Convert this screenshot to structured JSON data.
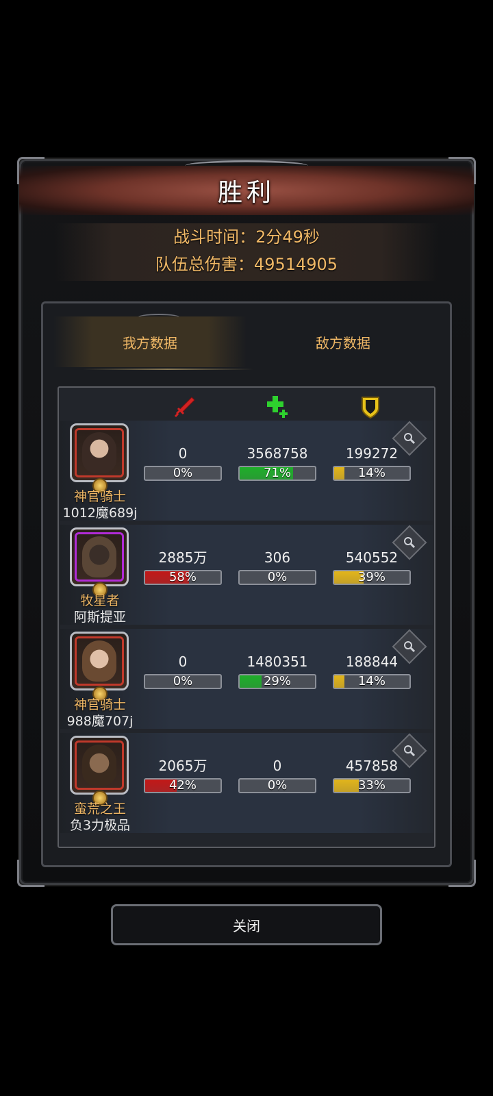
{
  "header": {
    "title": "胜利",
    "battle_time": "战斗时间：2分49秒",
    "team_damage": "队伍总伤害：49514905"
  },
  "tabs": [
    {
      "label": "我方数据",
      "active": true
    },
    {
      "label": "敌方数据",
      "active": false
    }
  ],
  "columns": [
    {
      "icon": "sword-icon",
      "color": "#d22222"
    },
    {
      "icon": "heal-cross-icon",
      "color": "#2ed12e"
    },
    {
      "icon": "shield-icon",
      "color": "#e7c21a"
    }
  ],
  "rows": [
    {
      "hero_class": "神官骑士",
      "player": "1012魔689j",
      "frame_color": "#c0392b",
      "damage": {
        "value": "0",
        "pct": "0%",
        "fraction": 0
      },
      "heal": {
        "value": "3568758",
        "pct": "71%",
        "fraction": 0.71
      },
      "tank": {
        "value": "199272",
        "pct": "14%",
        "fraction": 0.14
      }
    },
    {
      "hero_class": "牧星者",
      "player": "阿斯提亚",
      "frame_color": "#b12bd6",
      "damage": {
        "value": "2885万",
        "pct": "58%",
        "fraction": 0.58
      },
      "heal": {
        "value": "306",
        "pct": "0%",
        "fraction": 0
      },
      "tank": {
        "value": "540552",
        "pct": "39%",
        "fraction": 0.39
      }
    },
    {
      "hero_class": "神官骑士",
      "player": "988魔707j",
      "frame_color": "#c0392b",
      "damage": {
        "value": "0",
        "pct": "0%",
        "fraction": 0
      },
      "heal": {
        "value": "1480351",
        "pct": "29%",
        "fraction": 0.29
      },
      "tank": {
        "value": "188844",
        "pct": "14%",
        "fraction": 0.14
      }
    },
    {
      "hero_class": "蛮荒之王",
      "player": "负3力极品",
      "frame_color": "#c0392b",
      "damage": {
        "value": "2065万",
        "pct": "42%",
        "fraction": 0.42
      },
      "heal": {
        "value": "0",
        "pct": "0%",
        "fraction": 0
      },
      "tank": {
        "value": "457858",
        "pct": "33%",
        "fraction": 0.33
      }
    }
  ],
  "footer": {
    "close_label": "关闭"
  },
  "colors": {
    "damage_fill": "#c21818",
    "heal_fill": "#1fae2a",
    "tank_fill": "#e2b51b",
    "gold_text": "#f0b866"
  }
}
